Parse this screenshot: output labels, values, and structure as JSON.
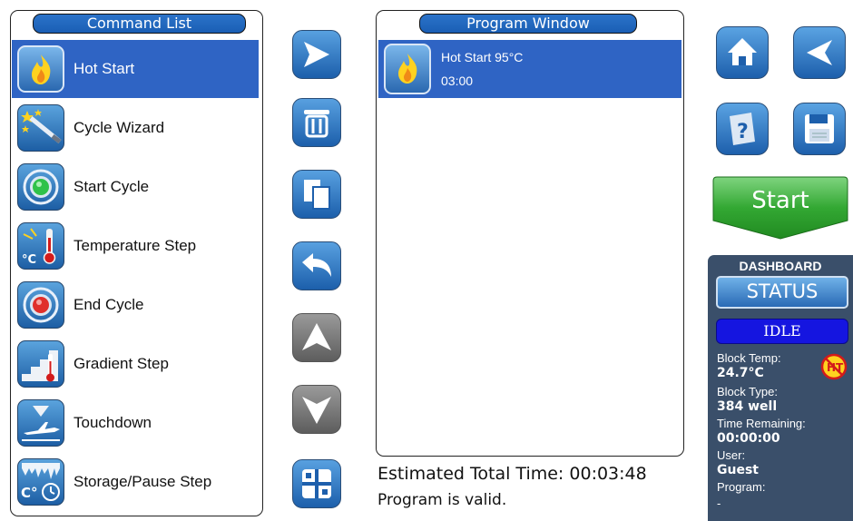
{
  "command_list": {
    "title": "Command List",
    "items": [
      {
        "label": "Hot Start",
        "icon": "flame-icon",
        "selected": true
      },
      {
        "label": "Cycle Wizard",
        "icon": "wizard-wand-icon"
      },
      {
        "label": "Start Cycle",
        "icon": "start-cycle-icon"
      },
      {
        "label": "Temperature Step",
        "icon": "thermometer-icon"
      },
      {
        "label": "End Cycle",
        "icon": "end-cycle-icon"
      },
      {
        "label": "Gradient Step",
        "icon": "gradient-step-icon"
      },
      {
        "label": "Touchdown",
        "icon": "touchdown-plane-icon"
      },
      {
        "label": "Storage/Pause Step",
        "icon": "storage-pause-icon"
      }
    ]
  },
  "toolbar": {
    "buttons": [
      "add-arrow-icon",
      "trash-icon",
      "copy-icon",
      "undo-icon",
      "move-up-icon",
      "move-down-icon",
      "details-icon"
    ]
  },
  "program_window": {
    "title": "Program Window",
    "steps": [
      {
        "name": "Hot Start 95°C",
        "time": "03:00",
        "icon": "flame-icon"
      }
    ],
    "estimated_label": "Estimated Total Time:",
    "estimated_time": "00:03:48",
    "status_text": "Program is valid."
  },
  "right_nav": {
    "buttons": [
      "home-icon",
      "back-icon",
      "help-book-icon",
      "save-floppy-icon"
    ],
    "start_label": "Start"
  },
  "dashboard": {
    "title": "DASHBOARD",
    "status_label": "STATUS",
    "state": "IDLE",
    "block_temp_label": "Block Temp:",
    "block_temp_value": "24.7°C",
    "hot_badge": "HT",
    "block_type_label": "Block Type:",
    "block_type_value": "384 well",
    "time_remaining_label": "Time Remaining:",
    "time_remaining_value": "00:00:00",
    "user_label": "User:",
    "user_value": "Guest",
    "program_label": "Program:",
    "program_value": "-"
  },
  "colors": {
    "selection": "#2f64c4",
    "accent_blue": "#1d5fac",
    "start_green": "#2fa22f",
    "dashboard_bg": "#3a4f6a",
    "idle_blue": "#1515e0"
  }
}
